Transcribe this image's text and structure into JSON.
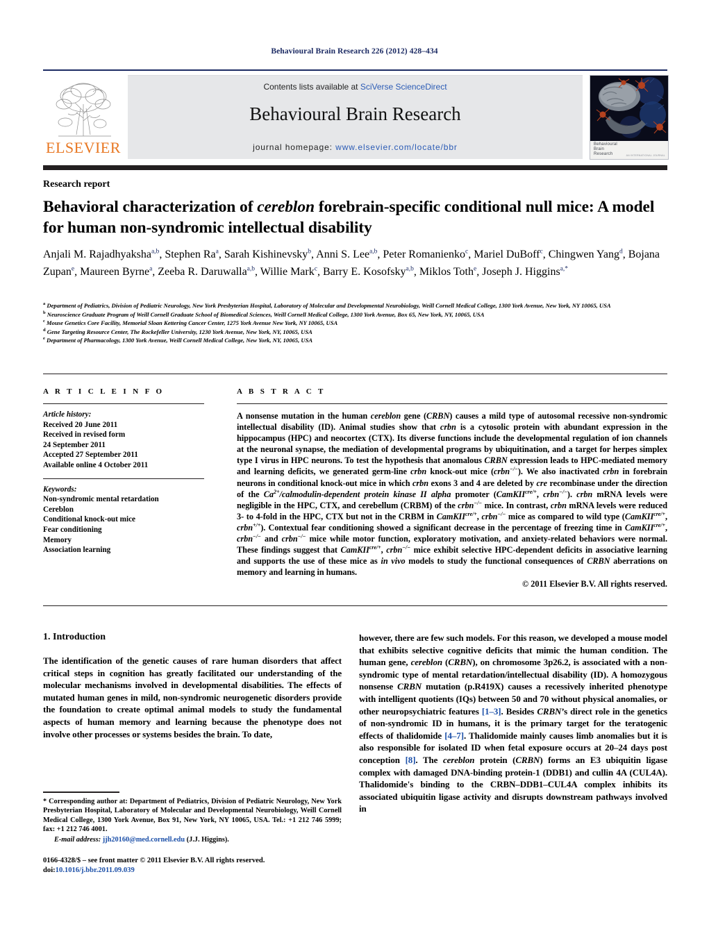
{
  "running_head": "Behavioural Brain Research 226 (2012) 428–434",
  "masthead": {
    "contents_prefix": "Contents lists available at ",
    "contents_link": "SciVerse ScienceDirect",
    "journal_title": "Behavioural Brain Research",
    "homepage_label": "journal homepage: ",
    "homepage_url": "www.elsevier.com/locate/bbr",
    "publisher_logo_text": "ELSEVIER",
    "cover_title_line1": "Behavioural",
    "cover_title_line2": "Brain",
    "cover_title_line3": "Research",
    "cover_footer": "AN INTERNATIONAL JOURNAL"
  },
  "colors": {
    "running_head": "#1b2a63",
    "link_blue": "#2b5bb5",
    "reference_blue": "#1b4fa8",
    "elsevier_orange": "#E87722",
    "banner_gray": "#e6e7e9",
    "rule_dark": "#231f20"
  },
  "article": {
    "section_type": "Research report",
    "title_part1": "Behavioral characterization of ",
    "title_italic": "cereblon",
    "title_part2": " forebrain-specific conditional null mice: A model for human non-syndromic intellectual disability",
    "authors": [
      {
        "name": "Anjali M. Rajadhyaksha",
        "sup": "a,b"
      },
      {
        "name": "Stephen Ra",
        "sup": "a"
      },
      {
        "name": "Sarah Kishinevsky",
        "sup": "b"
      },
      {
        "name": "Anni S. Lee",
        "sup": "a,b"
      },
      {
        "name": "Peter Romanienko",
        "sup": "c"
      },
      {
        "name": "Mariel DuBoff",
        "sup": "c"
      },
      {
        "name": "Chingwen Yang",
        "sup": "d"
      },
      {
        "name": "Bojana Zupan",
        "sup": "e"
      },
      {
        "name": "Maureen Byrne",
        "sup": "a"
      },
      {
        "name": "Zeeba R. Daruwalla",
        "sup": "a,b"
      },
      {
        "name": "Willie Mark",
        "sup": "c"
      },
      {
        "name": "Barry E. Kosofsky",
        "sup": "a,b"
      },
      {
        "name": "Miklos Toth",
        "sup": "e"
      },
      {
        "name": "Joseph J. Higgins",
        "sup": "a,*"
      }
    ],
    "affiliations": [
      {
        "mark": "a",
        "text": "Department of Pediatrics, Division of Pediatric Neurology, New York Presbyterian Hospital, Laboratory of Molecular and Developmental Neurobiology, Weill Cornell Medical College, 1300 York Avenue, New York, NY 10065, USA"
      },
      {
        "mark": "b",
        "text": "Neuroscience Graduate Program of Weill Cornell Graduate School of Biomedical Sciences, Weill Cornell Medical College, 1300 York Avenue, Box 65, New York, NY, 10065, USA"
      },
      {
        "mark": "c",
        "text": "Mouse Genetics Core Facility, Memorial Sloan Kettering Cancer Center, 1275 York Avenue New York, NY 10065, USA"
      },
      {
        "mark": "d",
        "text": "Gene Targeting Resource Center, The Rockefeller University, 1230 York Avenue, New York, NY, 10065, USA"
      },
      {
        "mark": "e",
        "text": "Department of Pharmacology, 1300 York Avenue, Weill Cornell Medical College, New York, NY, 10065, USA"
      }
    ]
  },
  "article_info": {
    "heading": "A R T I C L E    I N F O",
    "history_label": "Article history:",
    "history": [
      "Received 20 June 2011",
      "Received in revised form",
      "24 September 2011",
      "Accepted 27 September 2011",
      "Available online 4 October 2011"
    ],
    "keywords_label": "Keywords:",
    "keywords": [
      "Non-syndromic mental retardation",
      "Cereblon",
      "Conditional knock-out mice",
      "Fear conditioning",
      "Memory",
      "Association learning"
    ]
  },
  "abstract": {
    "heading": "A B S T R A C T",
    "text": "A nonsense mutation in the human cereblon gene (CRBN) causes a mild type of autosomal recessive non-syndromic intellectual disability (ID). Animal studies show that crbn is a cytosolic protein with abundant expression in the hippocampus (HPC) and neocortex (CTX). Its diverse functions include the developmental regulation of ion channels at the neuronal synapse, the mediation of developmental programs by ubiquitination, and a target for herpes simplex type I virus in HPC neurons. To test the hypothesis that anomalous CRBN expression leads to HPC-mediated memory and learning deficits, we generated germ-line crbn knock-out mice (crbn−/−). We also inactivated crbn in forebrain neurons in conditional knock-out mice in which crbn exons 3 and 4 are deleted by cre recombinase under the direction of the Ca2+/calmodulin-dependent protein kinase II alpha promoter (CamKIIcre/+, crbn−/−). crbn mRNA levels were negligible in the HPC, CTX, and cerebellum (CRBM) of the crbn−/− mice. In contrast, crbn mRNA levels were reduced 3- to 4-fold in the HPC, CTX but not in the CRBM in CamKIIcre/+, crbn−/− mice as compared to wild type (CamKIIcre/+, crbn+/+). Contextual fear conditioning showed a significant decrease in the percentage of freezing time in CamKIIcre/+, crbn−/− and crbn−/− mice while motor function, exploratory motivation, and anxiety-related behaviors were normal. These findings suggest that CamKIIcre/+, crbn−/− mice exhibit selective HPC-dependent deficits in associative learning and supports the use of these mice as in vivo models to study the functional consequences of CRBN aberrations on memory and learning in humans.",
    "copyright": "© 2011 Elsevier B.V. All rights reserved."
  },
  "body": {
    "section_heading": "1.  Introduction",
    "left_paragraph": "The identification of the genetic causes of rare human disorders that affect critical steps in cognition has greatly facilitated our understanding of the molecular mechanisms involved in developmental disabilities. The effects of mutated human genes in mild, non-syndromic neurogenetic disorders provide the foundation to create optimal animal models to study the fundamental aspects of human memory and learning because the phenotype does not involve other processes or systems besides the brain. To date,",
    "right_paragraph": "however, there are few such models. For this reason, we developed a mouse model that exhibits selective cognitive deficits that mimic the human condition. The human gene, cereblon (CRBN), on chromosome 3p26.2, is associated with a non-syndromic type of mental retardation/intellectual disability (ID). A homozygous nonsense CRBN mutation (p.R419X) causes a recessively inherited phenotype with intelligent quotients (IQs) between 50 and 70 without physical anomalies, or other neuropsychiatric features [1–3]. Besides CRBN's direct role in the genetics of non-syndromic ID in humans, it is the primary target for the teratogenic effects of thalidomide [4–7]. Thalidomide mainly causes limb anomalies but it is also responsible for isolated ID when fetal exposure occurs at 20–24 days post conception [8]. The cereblon protein (CRBN) forms an E3 ubiquitin ligase complex with damaged DNA-binding protein-1 (DDB1) and cullin 4A (CUL4A). Thalidomide's binding to the CRBN–DDB1–CUL4A complex inhibits its associated ubiquitin ligase activity and disrupts downstream pathways involved in"
  },
  "footnote": {
    "corresponding": "* Corresponding author at: Department of Pediatrics, Division of Pediatric Neurology, New York Presbyterian Hospital, Laboratory of Molecular and Developmental Neurobiology, Weill Cornell Medical College, 1300 York Avenue, Box 91, New York, NY 10065, USA. Tel.: +1 212 746 5999; fax: +1 212 746 4001.",
    "email_label": "E-mail address:",
    "email": "jjh20160@med.cornell.edu",
    "email_owner": "(J.J. Higgins).",
    "issn_line": "0166-4328/$ – see front matter © 2011 Elsevier B.V. All rights reserved.",
    "doi_label": "doi:",
    "doi": "10.1016/j.bbr.2011.09.039"
  }
}
